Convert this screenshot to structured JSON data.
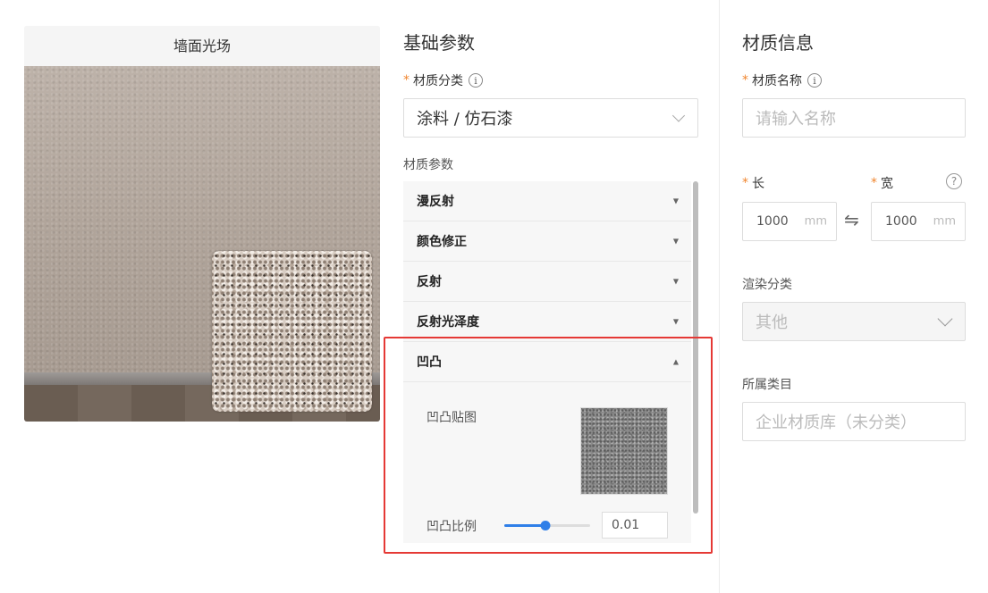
{
  "preview": {
    "title": "墙面光场"
  },
  "basic": {
    "title": "基础参数",
    "category_label": "材质分类",
    "category_value": "涂料 / 仿石漆",
    "params_label": "材质参数",
    "accordion": [
      {
        "label": "漫反射",
        "expanded": false
      },
      {
        "label": "颜色修正",
        "expanded": false
      },
      {
        "label": "反射",
        "expanded": false
      },
      {
        "label": "反射光泽度",
        "expanded": false
      },
      {
        "label": "凹凸",
        "expanded": true
      }
    ],
    "bump": {
      "map_label": "凹凸贴图",
      "ratio_label": "凹凸比例",
      "ratio_value": "0.01",
      "slider_level": 0.48
    }
  },
  "info": {
    "title": "材质信息",
    "name_label": "材质名称",
    "name_placeholder": "请输入名称",
    "length_label": "长",
    "width_label": "宽",
    "length_value": "1000",
    "width_value": "1000",
    "unit": "mm",
    "render_label": "渲染分类",
    "render_value": "其他",
    "catalog_label": "所属类目",
    "catalog_placeholder": "企业材质库（未分类）"
  },
  "colors": {
    "required": "#f0852d",
    "accent": "#2f7fe8",
    "highlight": "#e53935"
  },
  "icons": {
    "info": "info-circle-icon",
    "help": "question-circle-icon",
    "swap": "swap-arrows-icon",
    "chevron": "chevron-down-icon",
    "caret_down": "caret-down-icon",
    "caret_up": "caret-up-icon"
  }
}
